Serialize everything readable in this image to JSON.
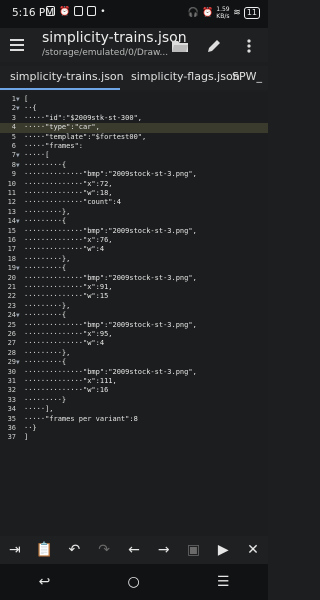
{
  "status_bar": {
    "time": "5:16 PM",
    "network_speed": "1.59 KB/s",
    "battery": "11"
  },
  "app_bar": {
    "title": "simplicity-trains.json",
    "subtitle": "/storage/emulated/0/Draw..."
  },
  "tabs": [
    {
      "label": "simplicity-trains.json",
      "active": true
    },
    {
      "label": "simplicity-flags.json",
      "active": false
    },
    {
      "label": "SPW_",
      "active": false
    }
  ],
  "editor": {
    "highlight_color": "#3a3b2c",
    "lines": [
      {
        "num": "1",
        "fold": "▼",
        "text": "["
      },
      {
        "num": "2",
        "fold": "▼",
        "text": "··{"
      },
      {
        "num": "3",
        "fold": "",
        "text": "·····\"id\":\"$2009stk-st-300\","
      },
      {
        "num": "4",
        "fold": "",
        "text": "·····\"type\":\"car\","
      },
      {
        "num": "5",
        "fold": "",
        "text": "·····\"template\":\"$fortest00\","
      },
      {
        "num": "6",
        "fold": "",
        "text": "·····\"frames\":"
      },
      {
        "num": "7",
        "fold": "▼",
        "text": "·····["
      },
      {
        "num": "8",
        "fold": "▼",
        "text": "·········{"
      },
      {
        "num": "9",
        "fold": "",
        "text": "··············\"bmp\":\"2009stock-st-3.png\","
      },
      {
        "num": "10",
        "fold": "",
        "text": "··············\"x\":72,"
      },
      {
        "num": "11",
        "fold": "",
        "text": "··············\"w\":18,"
      },
      {
        "num": "12",
        "fold": "",
        "text": "··············\"count\":4"
      },
      {
        "num": "13",
        "fold": "",
        "text": "·········},"
      },
      {
        "num": "14",
        "fold": "▼",
        "text": "·········{"
      },
      {
        "num": "15",
        "fold": "",
        "text": "··············\"bmp\":\"2009stock-st-3.png\","
      },
      {
        "num": "16",
        "fold": "",
        "text": "··············\"x\":76,"
      },
      {
        "num": "17",
        "fold": "",
        "text": "··············\"w\":4"
      },
      {
        "num": "18",
        "fold": "",
        "text": "·········},"
      },
      {
        "num": "19",
        "fold": "▼",
        "text": "·········{"
      },
      {
        "num": "20",
        "fold": "",
        "text": "··············\"bmp\":\"2009stock-st-3.png\","
      },
      {
        "num": "21",
        "fold": "",
        "text": "··············\"x\":91,"
      },
      {
        "num": "22",
        "fold": "",
        "text": "··············\"w\":15"
      },
      {
        "num": "23",
        "fold": "",
        "text": "·········},"
      },
      {
        "num": "24",
        "fold": "▼",
        "text": "·········{"
      },
      {
        "num": "25",
        "fold": "",
        "text": "··············\"bmp\":\"2009stock-st-3.png\","
      },
      {
        "num": "26",
        "fold": "",
        "text": "··············\"x\":95,"
      },
      {
        "num": "27",
        "fold": "",
        "text": "··············\"w\":4"
      },
      {
        "num": "28",
        "fold": "",
        "text": "·········},"
      },
      {
        "num": "29",
        "fold": "▼",
        "text": "·········{"
      },
      {
        "num": "30",
        "fold": "",
        "text": "··············\"bmp\":\"2009stock-st-3.png\","
      },
      {
        "num": "31",
        "fold": "",
        "text": "··············\"x\":111,"
      },
      {
        "num": "32",
        "fold": "",
        "text": "··············\"w\":16"
      },
      {
        "num": "33",
        "fold": "",
        "text": "·········}"
      },
      {
        "num": "34",
        "fold": "",
        "text": "·····],"
      },
      {
        "num": "35",
        "fold": "",
        "text": "·····\"frames per variant\":8"
      },
      {
        "num": "36",
        "fold": "",
        "text": "··}"
      },
      {
        "num": "37",
        "fold": "",
        "text": "]"
      }
    ],
    "highlighted_line": 4
  },
  "bottom_toolbar": [
    {
      "icon": "tab-indent-icon",
      "glyph": "⇥",
      "enabled": true
    },
    {
      "icon": "clipboard-icon",
      "glyph": "📋",
      "enabled": true
    },
    {
      "icon": "undo-icon",
      "glyph": "↶",
      "enabled": true
    },
    {
      "icon": "redo-icon",
      "glyph": "↷",
      "enabled": false
    },
    {
      "icon": "arrow-left-icon",
      "glyph": "←",
      "enabled": true
    },
    {
      "icon": "arrow-right-icon",
      "glyph": "→",
      "enabled": true
    },
    {
      "icon": "save-icon",
      "glyph": "▣",
      "enabled": false
    },
    {
      "icon": "run-icon",
      "glyph": "▶",
      "enabled": true
    },
    {
      "icon": "close-icon",
      "glyph": "✕",
      "enabled": true
    }
  ],
  "nav_bar": [
    {
      "icon": "back-icon",
      "glyph": "↩"
    },
    {
      "icon": "home-icon",
      "glyph": "○"
    },
    {
      "icon": "recents-icon",
      "glyph": "☰"
    }
  ]
}
